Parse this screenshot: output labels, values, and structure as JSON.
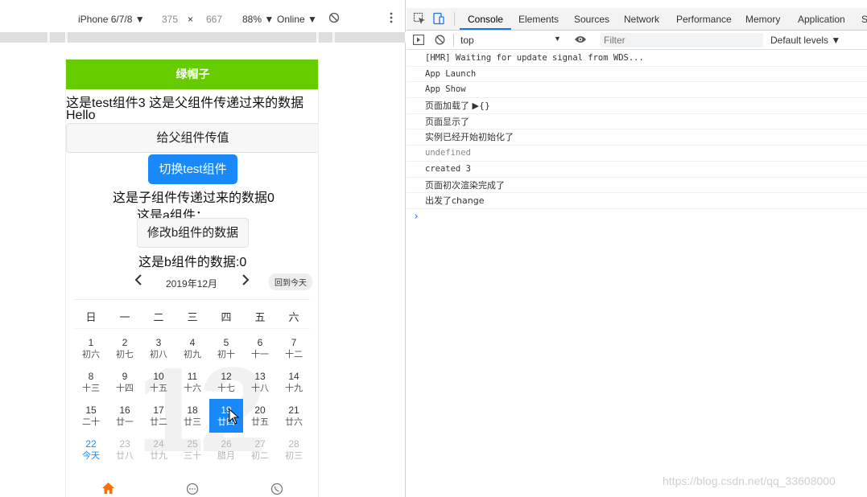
{
  "device_toolbar": {
    "device": "iPhone 6/7/8 ▼",
    "width": "375",
    "times": "×",
    "height": "667",
    "zoom": "88% ▼",
    "throttle": "Online ▼"
  },
  "phone": {
    "nav_title": "绿帽子",
    "line1": "这是test组件3 这是父组件传递过来的数据",
    "line2": "Hello",
    "btn_to_parent": "给父组件传值",
    "btn_switch": "切换test组件",
    "child_data": "这是子组件传递过来的数据0",
    "a_component": "这是a组件：",
    "btn_modify_b": "修改b组件的数据",
    "b_data": "这是b组件的数据:0",
    "calendar": {
      "prev": "‹",
      "month": "2019年12月",
      "next": "›",
      "today_btn": "回到今天",
      "watermark": "12",
      "weekdays": [
        "日",
        "一",
        "二",
        "三",
        "四",
        "五",
        "六"
      ],
      "rows": [
        [
          {
            "n": "1",
            "l": "初六"
          },
          {
            "n": "2",
            "l": "初七"
          },
          {
            "n": "3",
            "l": "初八"
          },
          {
            "n": "4",
            "l": "初九"
          },
          {
            "n": "5",
            "l": "初十"
          },
          {
            "n": "6",
            "l": "十一"
          },
          {
            "n": "7",
            "l": "十二"
          }
        ],
        [
          {
            "n": "8",
            "l": "十三"
          },
          {
            "n": "9",
            "l": "十四"
          },
          {
            "n": "10",
            "l": "十五"
          },
          {
            "n": "11",
            "l": "十六"
          },
          {
            "n": "12",
            "l": "十七"
          },
          {
            "n": "13",
            "l": "十八"
          },
          {
            "n": "14",
            "l": "十九"
          }
        ],
        [
          {
            "n": "15",
            "l": "二十"
          },
          {
            "n": "16",
            "l": "廿一"
          },
          {
            "n": "17",
            "l": "廿二"
          },
          {
            "n": "18",
            "l": "廿三"
          },
          {
            "n": "19",
            "l": "廿四"
          },
          {
            "n": "20",
            "l": "廿五"
          },
          {
            "n": "21",
            "l": "廿六"
          }
        ],
        [
          {
            "n": "22",
            "l": "今天"
          },
          {
            "n": "23",
            "l": "廿八"
          },
          {
            "n": "24",
            "l": "廿九"
          },
          {
            "n": "25",
            "l": "三十"
          },
          {
            "n": "26",
            "l": "腊月"
          },
          {
            "n": "27",
            "l": "初二"
          },
          {
            "n": "28",
            "l": "初三"
          }
        ]
      ]
    },
    "tabbar_icons": [
      "home-icon",
      "chat-icon",
      "phone-icon"
    ]
  },
  "devtools": {
    "tabs": [
      "Console",
      "Elements",
      "Sources",
      "Network",
      "Performance",
      "Memory",
      "Application",
      "S"
    ],
    "context": "top",
    "filter_placeholder": "Filter",
    "levels": "Default levels ▼",
    "logs": [
      "[HMR] Waiting for update signal from WDS...",
      "App Launch",
      "App Show",
      "页面加载了 ▶{}",
      "页面显示了",
      "实例已经开始初始化了",
      "undefined",
      "created 3",
      "页面初次渲染完成了",
      "出发了change"
    ],
    "prompt": "›"
  },
  "watermark": "https://blog.csdn.net/qq_33608000",
  "colors": {
    "nav_green": "#66cc00",
    "accent_blue": "#1989fa",
    "devtools_blue": "#1a73e8"
  }
}
